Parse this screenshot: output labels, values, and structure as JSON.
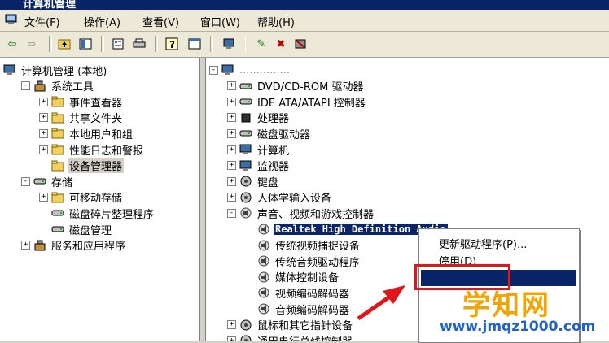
{
  "window": {
    "title": "计算机管理"
  },
  "menu": {
    "items": [
      "文件(F)",
      "操作(A)",
      "查看(V)",
      "窗口(W)",
      "帮助(H)"
    ]
  },
  "toolbar": {
    "icons": [
      "back-arrow-icon",
      "forward-arrow-icon",
      "up-folder-icon",
      "show-hide-tree-icon",
      "properties-icon",
      "print-icon",
      "help-icon",
      "console-view-icon",
      "scan-hardware-icon",
      "update-driver-icon",
      "uninstall-icon",
      "disable-device-icon"
    ]
  },
  "left_tree": {
    "root": "计算机管理 (本地)",
    "items": [
      {
        "label": "系统工具",
        "level": 1,
        "expander": "-"
      },
      {
        "label": "事件查看器",
        "level": 2,
        "expander": "+"
      },
      {
        "label": "共享文件夹",
        "level": 2,
        "expander": "+"
      },
      {
        "label": "本地用户和组",
        "level": 2,
        "expander": "+"
      },
      {
        "label": "性能日志和警报",
        "level": 2,
        "expander": "+"
      },
      {
        "label": "设备管理器",
        "level": 2,
        "expander": "",
        "selected": true
      },
      {
        "label": "存储",
        "level": 1,
        "expander": "-"
      },
      {
        "label": "可移动存储",
        "level": 2,
        "expander": "+"
      },
      {
        "label": "磁盘碎片整理程序",
        "level": 2,
        "expander": ""
      },
      {
        "label": "磁盘管理",
        "level": 2,
        "expander": ""
      },
      {
        "label": "服务和应用程序",
        "level": 1,
        "expander": "+"
      }
    ]
  },
  "right_tree": {
    "root": "...............",
    "items": [
      {
        "label": "DVD/CD-ROM 驱动器",
        "level": 1,
        "expander": "+"
      },
      {
        "label": "IDE ATA/ATAPI 控制器",
        "level": 1,
        "expander": "+"
      },
      {
        "label": "处理器",
        "level": 1,
        "expander": "+"
      },
      {
        "label": "磁盘驱动器",
        "level": 1,
        "expander": "+"
      },
      {
        "label": "计算机",
        "level": 1,
        "expander": "+"
      },
      {
        "label": "监视器",
        "level": 1,
        "expander": "+"
      },
      {
        "label": "键盘",
        "level": 1,
        "expander": "+"
      },
      {
        "label": "人体学输入设备",
        "level": 1,
        "expander": "+"
      },
      {
        "label": "声音、视频和游戏控制器",
        "level": 1,
        "expander": "-"
      },
      {
        "label": "Realtek High Definition Audio",
        "level": 2,
        "expander": "",
        "highlighted": true
      },
      {
        "label": "传统视频捕捉设备",
        "level": 2,
        "expander": ""
      },
      {
        "label": "传统音频驱动程序",
        "level": 2,
        "expander": ""
      },
      {
        "label": "媒体控制设备",
        "level": 2,
        "expander": ""
      },
      {
        "label": "视频编码解码器",
        "level": 2,
        "expander": ""
      },
      {
        "label": "音频编码解码器",
        "level": 2,
        "expander": ""
      },
      {
        "label": "鼠标和其它指针设备",
        "level": 1,
        "expander": "+"
      },
      {
        "label": "通用串行总线控制器",
        "level": 1,
        "expander": "+"
      }
    ]
  },
  "context_menu": {
    "items": [
      "更新驱动程序(P)...",
      "停用(D)"
    ]
  },
  "watermark": {
    "brand": "学知网",
    "url": "www.jmqz1000.com"
  },
  "colors": {
    "selection": "#0a246a",
    "red_box": "#e0161b",
    "watermark_orange": "#f5a300",
    "watermark_blue": "#1f62c9"
  }
}
